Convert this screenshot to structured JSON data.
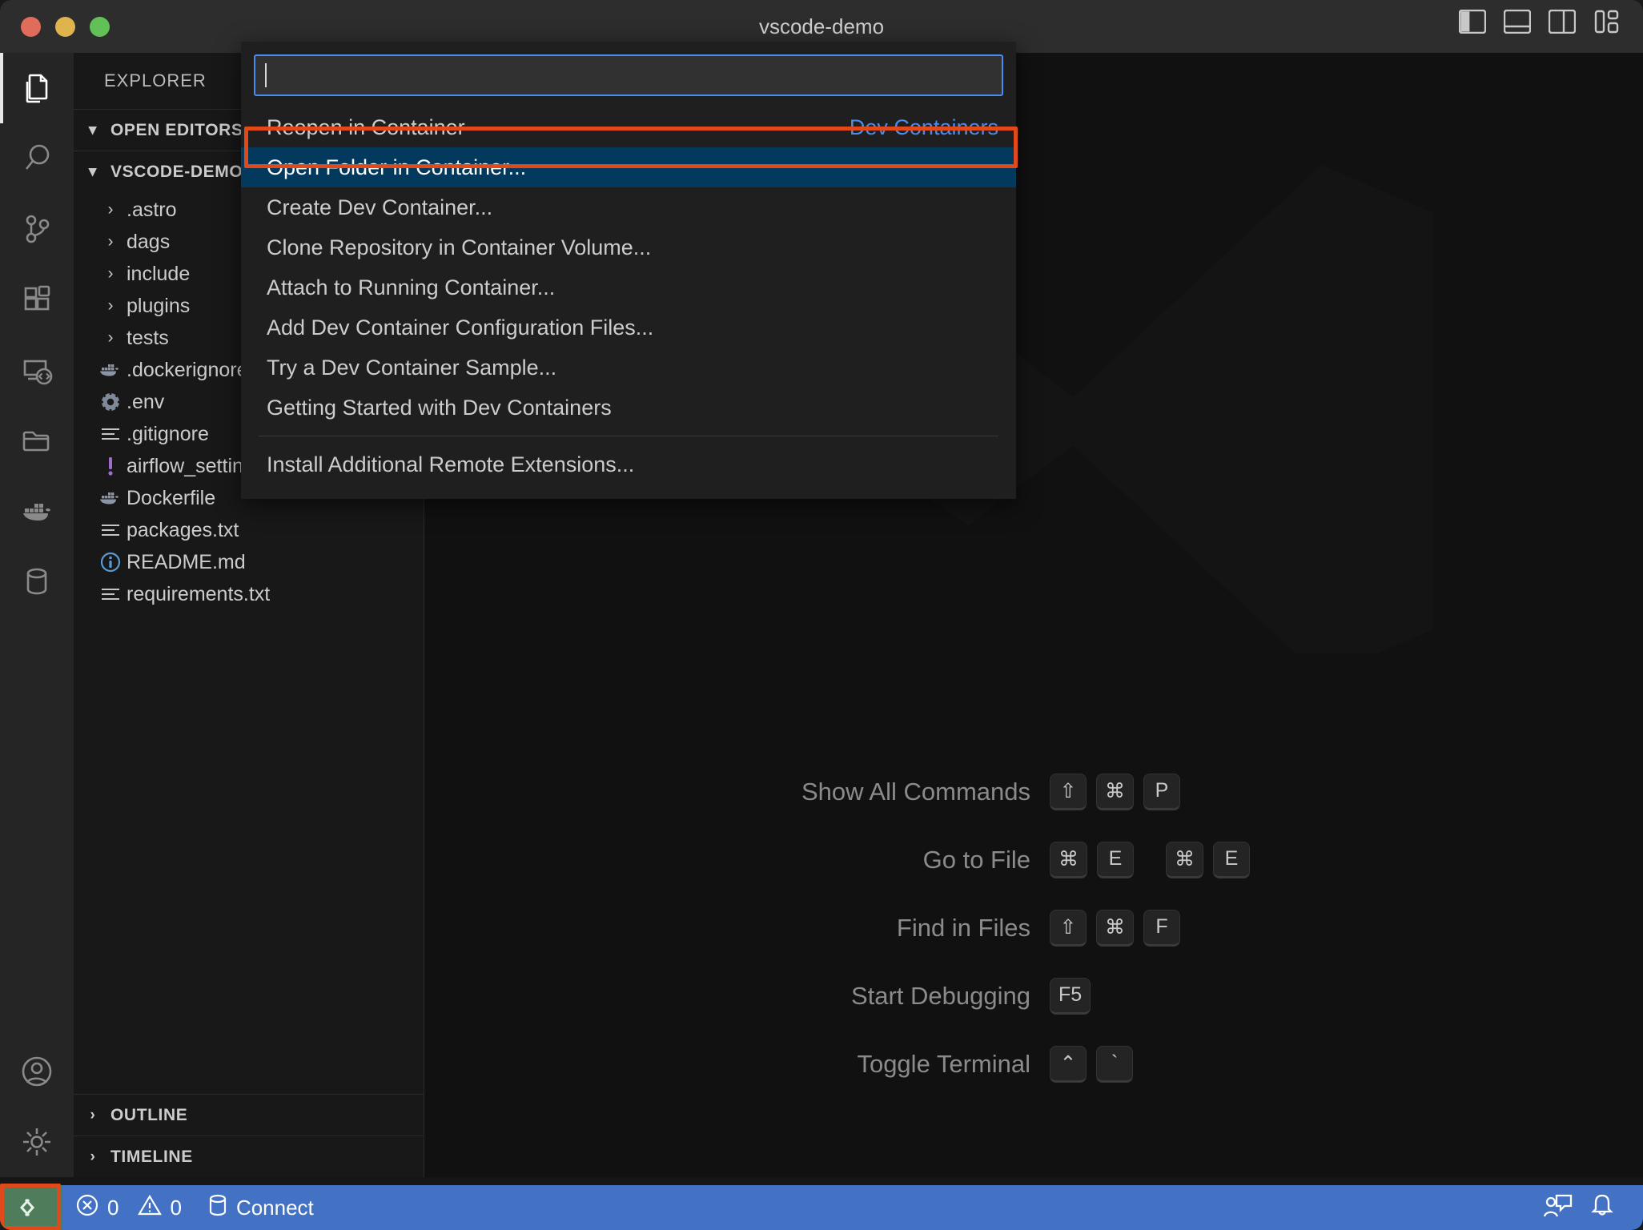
{
  "window": {
    "title": "vscode-demo",
    "traffic_lights": [
      "close-red",
      "minimize-yellow",
      "maximize-green"
    ],
    "layout_icons": [
      "toggle-primary-sidebar",
      "toggle-panel",
      "toggle-secondary-sidebar",
      "customize-layout"
    ]
  },
  "activity_bar": {
    "items": [
      {
        "name": "explorer",
        "icon": "files-icon",
        "active": true
      },
      {
        "name": "search",
        "icon": "search-icon",
        "active": false
      },
      {
        "name": "source-control",
        "icon": "source-control-icon",
        "active": false
      },
      {
        "name": "extensions",
        "icon": "extensions-icon",
        "active": false
      },
      {
        "name": "remote-explorer",
        "icon": "remote-explorer-icon",
        "active": false
      },
      {
        "name": "folder-explorer",
        "icon": "folder-icon",
        "active": false
      },
      {
        "name": "docker",
        "icon": "docker-whale-icon",
        "active": false
      },
      {
        "name": "database",
        "icon": "database-icon",
        "active": false
      }
    ],
    "bottom_items": [
      {
        "name": "accounts",
        "icon": "account-icon"
      },
      {
        "name": "manage-settings",
        "icon": "gear-icon"
      }
    ]
  },
  "sidebar": {
    "title": "EXPLORER",
    "sections": [
      {
        "label": "OPEN EDITORS",
        "expanded": true
      },
      {
        "label": "VSCODE-DEMO",
        "expanded": true
      }
    ],
    "tree": [
      {
        "name": ".astro",
        "type": "folder",
        "icon": "chevron-right",
        "expanded": false
      },
      {
        "name": "dags",
        "type": "folder",
        "icon": "chevron-right",
        "expanded": false
      },
      {
        "name": "include",
        "type": "folder",
        "icon": "chevron-right",
        "expanded": false
      },
      {
        "name": "plugins",
        "type": "folder",
        "icon": "chevron-right",
        "expanded": false
      },
      {
        "name": "tests",
        "type": "folder",
        "icon": "chevron-right",
        "expanded": false
      },
      {
        "name": ".dockerignore",
        "type": "file",
        "icon": "docker-whale-icon"
      },
      {
        "name": ".env",
        "type": "file",
        "icon": "gear-icon"
      },
      {
        "name": ".gitignore",
        "type": "file",
        "icon": "lines-icon"
      },
      {
        "name": "airflow_settings.yaml",
        "type": "file",
        "icon": "yaml-exclamation-icon"
      },
      {
        "name": "Dockerfile",
        "type": "file",
        "icon": "docker-whale-icon"
      },
      {
        "name": "packages.txt",
        "type": "file",
        "icon": "lines-icon"
      },
      {
        "name": "README.md",
        "type": "file",
        "icon": "info-circle-icon"
      },
      {
        "name": "requirements.txt",
        "type": "file",
        "icon": "lines-icon"
      }
    ],
    "bottom_sections": [
      {
        "label": "OUTLINE",
        "expanded": false
      },
      {
        "label": "TIMELINE",
        "expanded": false
      }
    ]
  },
  "command_palette": {
    "input_value": "",
    "placeholder": "",
    "items": [
      {
        "label": "Reopen in Container",
        "right": "Dev Containers",
        "selected": false,
        "separator_before": false
      },
      {
        "label": "Open Folder in Container...",
        "right": "",
        "selected": true,
        "separator_before": false
      },
      {
        "label": "Create Dev Container...",
        "right": "",
        "selected": false,
        "separator_before": false
      },
      {
        "label": "Clone Repository in Container Volume...",
        "right": "",
        "selected": false,
        "separator_before": false
      },
      {
        "label": "Attach to Running Container...",
        "right": "",
        "selected": false,
        "separator_before": false
      },
      {
        "label": "Add Dev Container Configuration Files...",
        "right": "",
        "selected": false,
        "separator_before": false
      },
      {
        "label": "Try a Dev Container Sample...",
        "right": "",
        "selected": false,
        "separator_before": false
      },
      {
        "label": "Getting Started with Dev Containers",
        "right": "",
        "selected": false,
        "separator_before": false
      },
      {
        "label": "Install Additional Remote Extensions...",
        "right": "",
        "selected": false,
        "separator_before": true
      }
    ]
  },
  "editor_watermark": {
    "shortcuts": [
      {
        "label": "Show All Commands",
        "keys": [
          "⇧",
          "⌘",
          "P"
        ],
        "groups": [
          3
        ]
      },
      {
        "label": "Go to File",
        "keys": [
          "⌘",
          "E",
          "⌘",
          "E"
        ],
        "groups": [
          2,
          2
        ]
      },
      {
        "label": "Find in Files",
        "keys": [
          "⇧",
          "⌘",
          "F"
        ],
        "groups": [
          3
        ]
      },
      {
        "label": "Start Debugging",
        "keys": [
          "F5"
        ],
        "groups": [
          1
        ]
      },
      {
        "label": "Toggle Terminal",
        "keys": [
          "⌃",
          "`"
        ],
        "groups": [
          2
        ]
      }
    ]
  },
  "status_bar": {
    "remote_indicator": {
      "label": "",
      "icon": "remote-arrows-icon",
      "color": "#4f7d5c"
    },
    "errors": {
      "icon": "error-circle-icon",
      "count": "0"
    },
    "warnings": {
      "icon": "warning-triangle-icon",
      "count": "0"
    },
    "database": {
      "icon": "database-icon",
      "label": "Connect"
    },
    "right_items": [
      {
        "name": "feedback",
        "icon": "feedback-person-icon"
      },
      {
        "name": "notifications",
        "icon": "bell-icon"
      }
    ],
    "background": "#4372c4"
  },
  "annotations": [
    {
      "name": "highlight-open-folder-in-container",
      "color": "#e04a1a"
    },
    {
      "name": "highlight-remote-indicator",
      "color": "#e04a1a"
    }
  ]
}
